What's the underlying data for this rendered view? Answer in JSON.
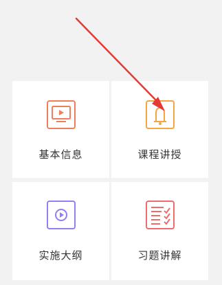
{
  "menu": {
    "items": [
      {
        "label": "基本信息",
        "icon": "tv-icon",
        "color": "#ef7f5a"
      },
      {
        "label": "课程讲授",
        "icon": "bell-icon",
        "color": "#f2a541"
      },
      {
        "label": "实施大纲",
        "icon": "play-circle-icon",
        "color": "#8f7ff2"
      },
      {
        "label": "习题讲解",
        "icon": "checklist-icon",
        "color": "#ee6b6b"
      }
    ]
  },
  "annotation": {
    "color": "#e53935"
  }
}
